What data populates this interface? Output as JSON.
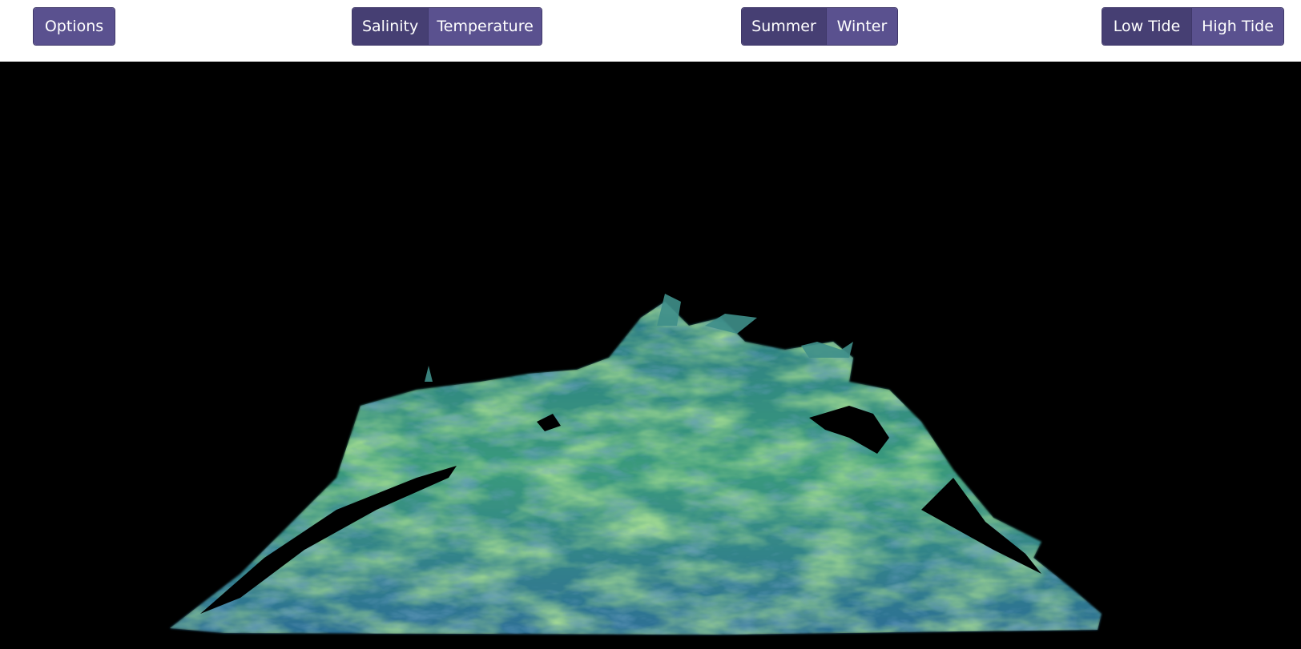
{
  "toolbar": {
    "options_label": "Options",
    "variable": {
      "options": [
        "Salinity",
        "Temperature"
      ],
      "selected": "Salinity"
    },
    "season": {
      "options": [
        "Summer",
        "Winter"
      ],
      "selected": "Summer"
    },
    "tide": {
      "options": [
        "Low Tide",
        "High Tide"
      ],
      "selected": "Low Tide"
    }
  },
  "colors": {
    "button": "#5a518f",
    "button_active": "#463f73",
    "button_border": "#3f3869",
    "viewport_background": "#000000",
    "volume_low": "#1b4a7a",
    "volume_mid": "#2e8c7e",
    "volume_high": "#8fd14f"
  }
}
